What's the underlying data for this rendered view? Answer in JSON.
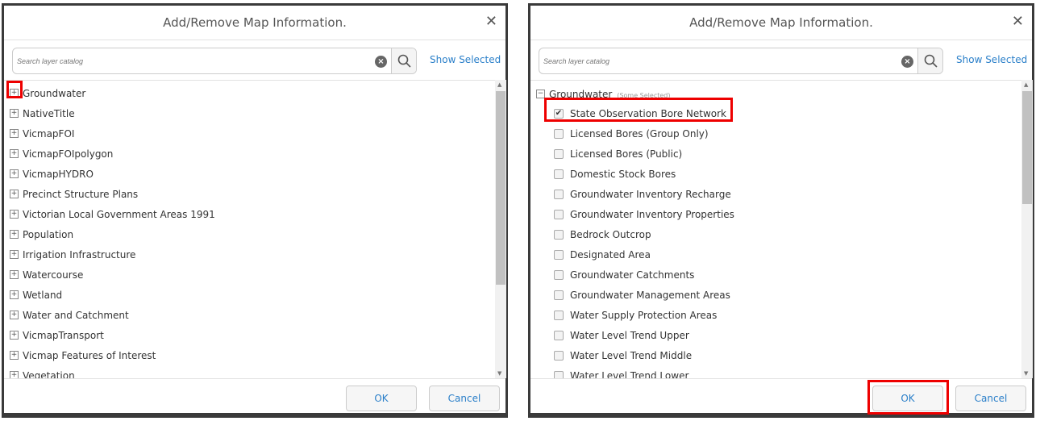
{
  "dialogs": [
    {
      "title": "Add/Remove Map Information.",
      "search": {
        "placeholder": "Search layer catalog"
      },
      "show_selected": "Show Selected",
      "ok": "OK",
      "cancel": "Cancel",
      "items": [
        "Groundwater",
        "NativeTitle",
        "VicmapFOI",
        "VicmapFOIpolygon",
        "VicmapHYDRO",
        "Precinct Structure Plans",
        "Victorian Local Government Areas 1991",
        "Population",
        "Irrigation Infrastructure",
        "Watercourse",
        "Wetland",
        "Water and Catchment",
        "VicmapTransport",
        "Vicmap Features of Interest",
        "Vegetation"
      ]
    },
    {
      "title": "Add/Remove Map Information.",
      "search": {
        "placeholder": "Search layer catalog"
      },
      "show_selected": "Show Selected",
      "ok": "OK",
      "cancel": "Cancel",
      "group": {
        "label": "Groundwater",
        "status": "(Some Selected)"
      },
      "items": [
        {
          "label": "State Observation Bore Network",
          "checked": true
        },
        {
          "label": "Licensed Bores (Group Only)",
          "checked": false
        },
        {
          "label": "Licensed Bores (Public)",
          "checked": false
        },
        {
          "label": "Domestic Stock Bores",
          "checked": false
        },
        {
          "label": "Groundwater Inventory Recharge",
          "checked": false
        },
        {
          "label": "Groundwater Inventory Properties",
          "checked": false
        },
        {
          "label": "Bedrock Outcrop",
          "checked": false
        },
        {
          "label": "Designated Area",
          "checked": false
        },
        {
          "label": "Groundwater Catchments",
          "checked": false
        },
        {
          "label": "Groundwater Management Areas",
          "checked": false
        },
        {
          "label": "Water Supply Protection Areas",
          "checked": false
        },
        {
          "label": "Water Level Trend Upper",
          "checked": false
        },
        {
          "label": "Water Level Trend Middle",
          "checked": false
        },
        {
          "label": "Water Level Trend Lower",
          "checked": false
        }
      ]
    }
  ],
  "colors": {
    "highlight": "#e00000",
    "link": "#2a7fc9"
  }
}
